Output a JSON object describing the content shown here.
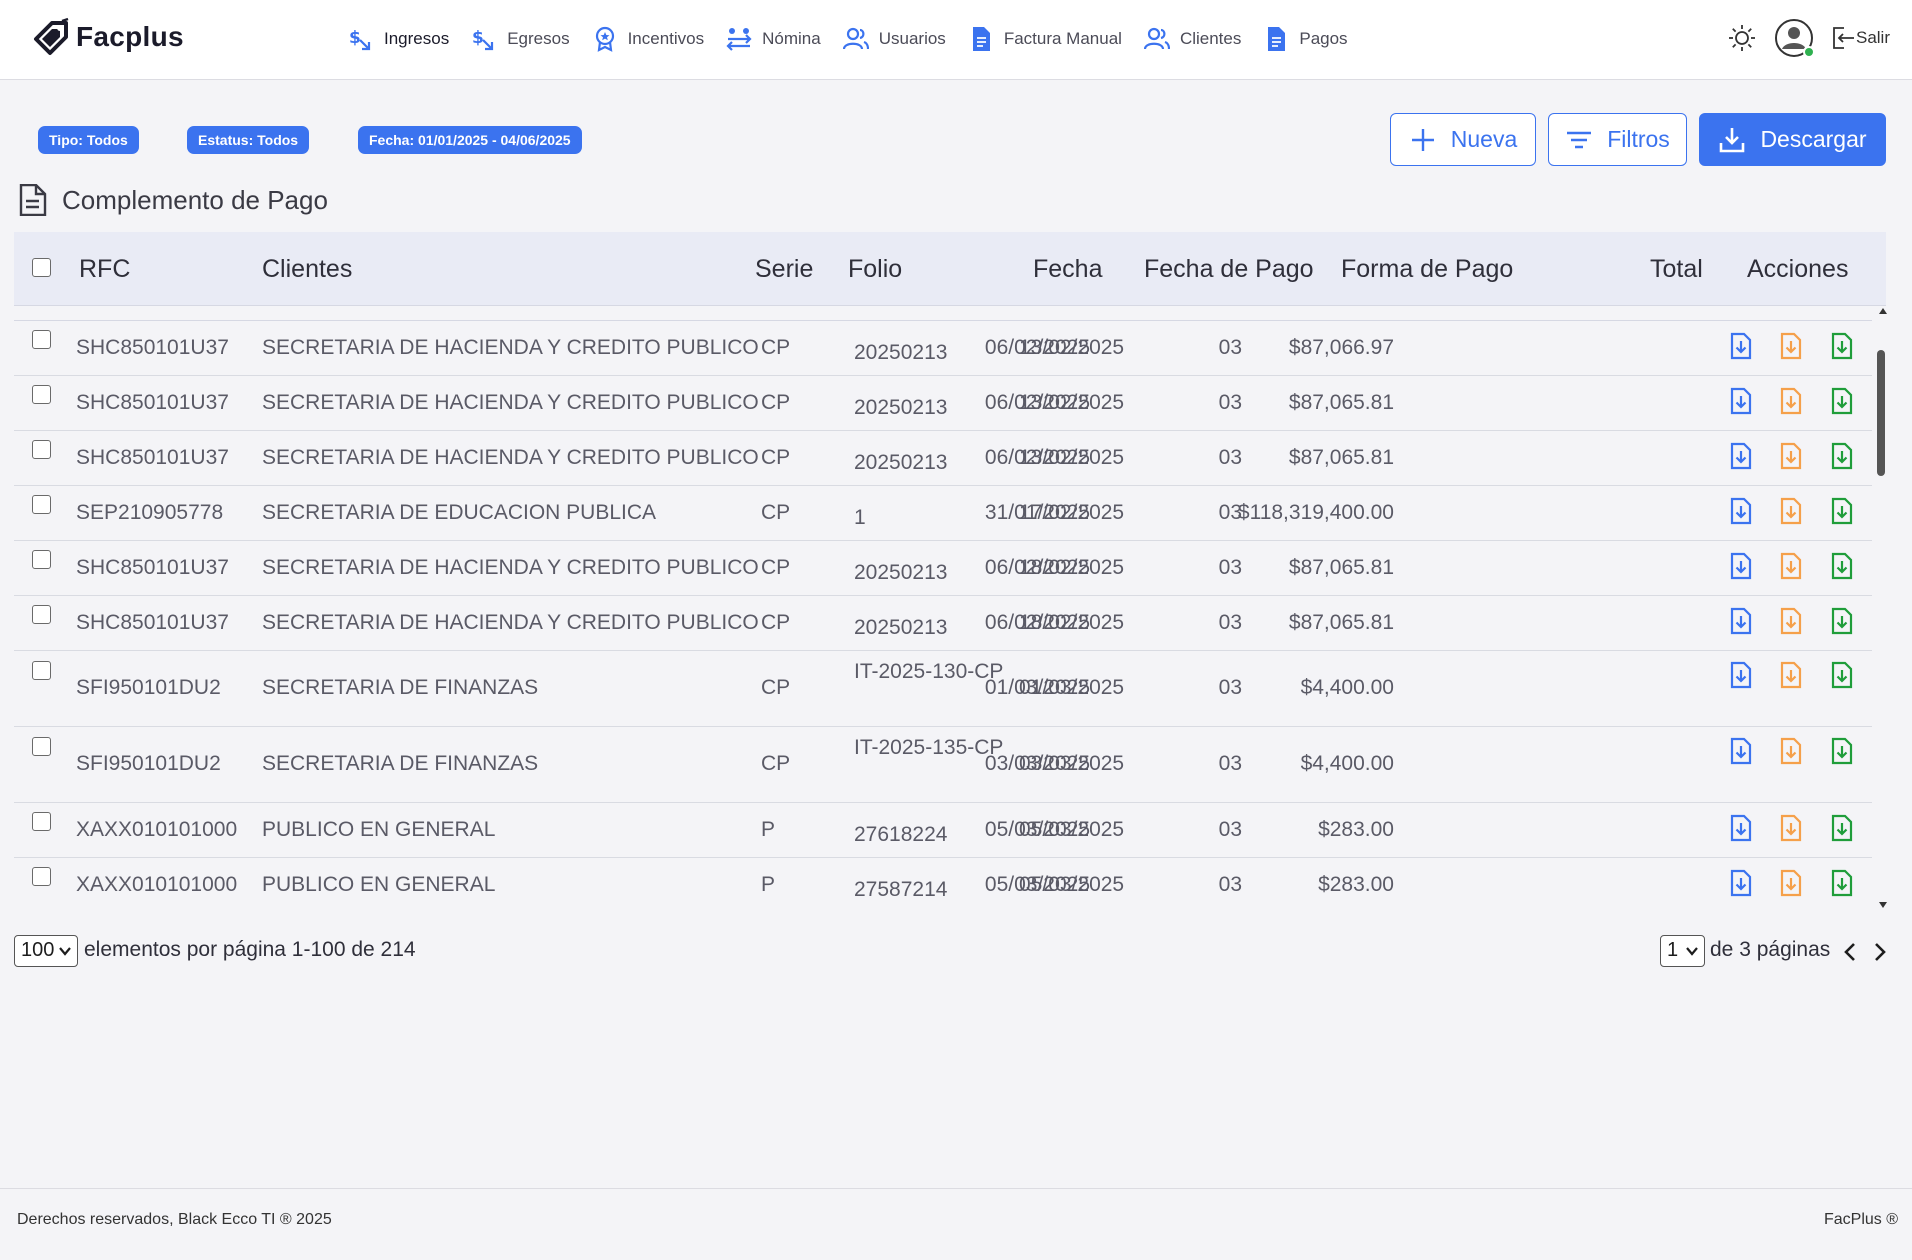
{
  "brand": {
    "name": "Facplus"
  },
  "nav": [
    {
      "label": "Ingresos",
      "icon": "income-icon"
    },
    {
      "label": "Egresos",
      "icon": "expense-icon"
    },
    {
      "label": "Incentivos",
      "icon": "award-icon"
    },
    {
      "label": "Nómina",
      "icon": "payroll-icon"
    },
    {
      "label": "Usuarios",
      "icon": "users-icon"
    },
    {
      "label": "Factura Manual",
      "icon": "document-icon"
    },
    {
      "label": "Clientes",
      "icon": "clients-icon"
    },
    {
      "label": "Pagos",
      "icon": "document-icon"
    }
  ],
  "header": {
    "logout_label": "Salir"
  },
  "filters": {
    "tipo": "Tipo: Todos",
    "estatus": "Estatus: Todos",
    "fecha": "Fecha: 01/01/2025 - 04/06/2025"
  },
  "actions": {
    "new_label": "Nueva",
    "filters_label": "Filtros",
    "download_label": "Descargar"
  },
  "page": {
    "title": "Complemento de Pago"
  },
  "table": {
    "columns": [
      "RFC",
      "Clientes",
      "Serie",
      "Folio",
      "Fecha",
      "Fecha de Pago",
      "Forma de Pago",
      "Total",
      "Acciones"
    ],
    "rows": [
      {
        "rfc": "SHC850101U37",
        "cliente": "SECRETARIA DE HACIENDA Y CREDITO PUBLICO",
        "serie": "CP",
        "folio": "20250213",
        "fecha": "13/02/2025",
        "fecha_pago": "06/02/2025",
        "forma_pago": "03",
        "total": "$87,066.97"
      },
      {
        "rfc": "SHC850101U37",
        "cliente": "SECRETARIA DE HACIENDA Y CREDITO PUBLICO",
        "serie": "CP",
        "folio": "20250213",
        "fecha": "13/02/2025",
        "fecha_pago": "06/02/2025",
        "forma_pago": "03",
        "total": "$87,065.81"
      },
      {
        "rfc": "SHC850101U37",
        "cliente": "SECRETARIA DE HACIENDA Y CREDITO PUBLICO",
        "serie": "CP",
        "folio": "20250213",
        "fecha": "13/02/2025",
        "fecha_pago": "06/02/2025",
        "forma_pago": "03",
        "total": "$87,065.81"
      },
      {
        "rfc": "SEP210905778",
        "cliente": "SECRETARIA DE EDUCACION PUBLICA",
        "serie": "CP",
        "folio": "1",
        "fecha": "17/02/2025",
        "fecha_pago": "31/01/2025",
        "forma_pago": "03",
        "total": "$118,319,400.00"
      },
      {
        "rfc": "SHC850101U37",
        "cliente": "SECRETARIA DE HACIENDA Y CREDITO PUBLICO",
        "serie": "CP",
        "folio": "20250213",
        "fecha": "18/02/2025",
        "fecha_pago": "06/02/2025",
        "forma_pago": "03",
        "total": "$87,065.81"
      },
      {
        "rfc": "SHC850101U37",
        "cliente": "SECRETARIA DE HACIENDA Y CREDITO PUBLICO",
        "serie": "CP",
        "folio": "20250213",
        "fecha": "18/02/2025",
        "fecha_pago": "06/02/2025",
        "forma_pago": "03",
        "total": "$87,065.81"
      },
      {
        "rfc": "SFI950101DU2",
        "cliente": "SECRETARIA DE FINANZAS",
        "serie": "CP",
        "folio": "IT-2025-130-CP",
        "fecha": "01/03/2025",
        "fecha_pago": "01/03/2025",
        "forma_pago": "03",
        "total": "$4,400.00"
      },
      {
        "rfc": "SFI950101DU2",
        "cliente": "SECRETARIA DE FINANZAS",
        "serie": "CP",
        "folio": "IT-2025-135-CP",
        "fecha": "03/03/2025",
        "fecha_pago": "03/03/2025",
        "forma_pago": "03",
        "total": "$4,400.00"
      },
      {
        "rfc": "XAXX010101000",
        "cliente": "PUBLICO EN GENERAL",
        "serie": "P",
        "folio": "27618224",
        "fecha": "05/03/2025",
        "fecha_pago": "05/03/2025",
        "forma_pago": "03",
        "total": "$283.00"
      },
      {
        "rfc": "XAXX010101000",
        "cliente": "PUBLICO EN GENERAL",
        "serie": "P",
        "folio": "27587214",
        "fecha": "05/03/2025",
        "fecha_pago": "05/03/2025",
        "forma_pago": "03",
        "total": "$283.00"
      }
    ],
    "row_actions": [
      {
        "icon": "download-blue-icon",
        "color": "#3b73ef"
      },
      {
        "icon": "download-orange-icon",
        "color": "#f5a04a"
      },
      {
        "icon": "download-green-icon",
        "color": "#1f9d3a"
      }
    ]
  },
  "pagination": {
    "page_size": "100",
    "summary": "elementos por página 1-100 de 214",
    "current_page": "1",
    "pages_label": "de 3 páginas"
  },
  "footer": {
    "left": "Derechos reservados, Black Ecco TI ® 2025",
    "right": "FacPlus ®"
  },
  "colors": {
    "accent": "#3b73ef",
    "header_bg": "#e9ebf5",
    "page_bg": "#f4f4f7"
  }
}
